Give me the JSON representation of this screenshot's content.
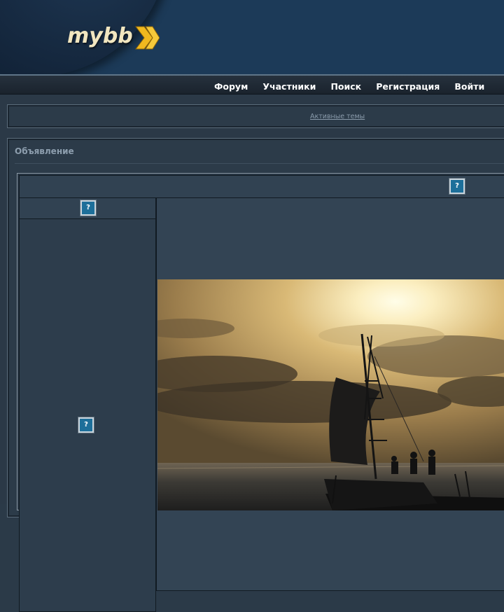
{
  "header": {
    "logo_text": "mybb",
    "logo_chevrons": "chevron-double-right-icon"
  },
  "nav": {
    "items": [
      "Форум",
      "Участники",
      "Поиск",
      "Регистрация",
      "Войти"
    ]
  },
  "links": {
    "active_topics": "Активные темы"
  },
  "announcement": {
    "title": "Объявление"
  },
  "missing_images": {
    "glyph": "?"
  },
  "photo": {
    "subject": "sailing-raft-sunset-image"
  },
  "colors": {
    "header_bg": "#1c3a58",
    "body_bg": "#2b3947",
    "nav_text": "#ffffff",
    "logo_chevron": "#f0b81f"
  }
}
